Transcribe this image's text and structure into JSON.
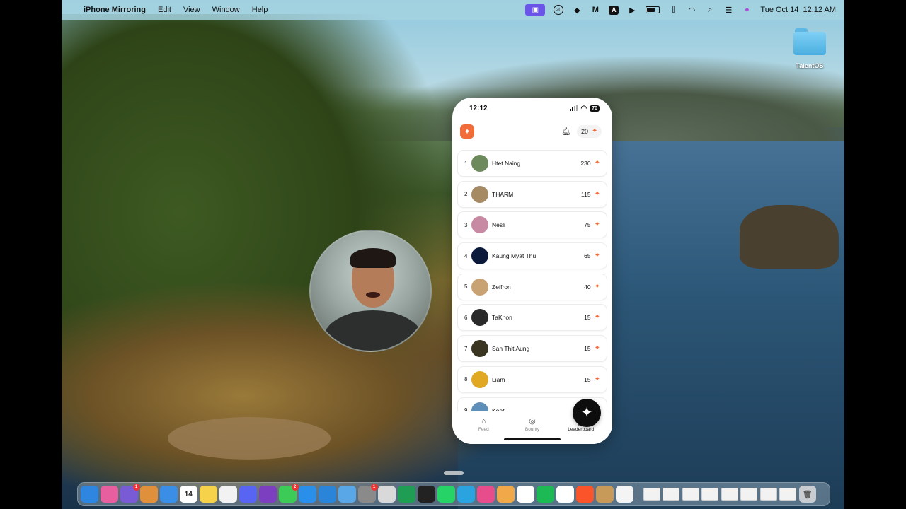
{
  "menubar": {
    "app_name": "iPhone Mirroring",
    "menus": [
      "Edit",
      "View",
      "Window",
      "Help"
    ],
    "status_icons": [
      "screen-mirroring-icon",
      "notification-count-icon",
      "dropbox-icon",
      "m-app-icon",
      "a-input-icon",
      "play-icon",
      "battery-icon",
      "tunnel-icon",
      "wifi-icon",
      "search-icon",
      "control-center-icon",
      "siri-icon"
    ],
    "notification_count": "20",
    "input_letter": "A",
    "datetime": "Tue Oct 14  12:12 AM"
  },
  "desktop": {
    "folder_label": "TalentOS"
  },
  "phone": {
    "status_time": "12:12",
    "battery": "70",
    "points": "20",
    "leaderboard": [
      {
        "rank": "1",
        "name": "Htet Naing",
        "score": "230",
        "avatar_color": "#6d8a5c"
      },
      {
        "rank": "2",
        "name": "THARM",
        "score": "115",
        "avatar_color": "#a58a63"
      },
      {
        "rank": "3",
        "name": "Nesli",
        "score": "75",
        "avatar_color": "#c78aa2"
      },
      {
        "rank": "4",
        "name": "Kaung Myat Thu",
        "score": "65",
        "avatar_color": "#0b1a3a"
      },
      {
        "rank": "5",
        "name": "Zeffron",
        "score": "40",
        "avatar_color": "#c9a273"
      },
      {
        "rank": "6",
        "name": "TaKhon",
        "score": "15",
        "avatar_color": "#2a2a2a"
      },
      {
        "rank": "7",
        "name": "San Thit Aung",
        "score": "15",
        "avatar_color": "#3a3520"
      },
      {
        "rank": "8",
        "name": "Liam",
        "score": "15",
        "avatar_color": "#e0a823"
      },
      {
        "rank": "9",
        "name": "Koof",
        "score": "",
        "avatar_color": "#5e8fb8"
      }
    ],
    "tabs": [
      {
        "label": "Feed",
        "icon": "home-icon"
      },
      {
        "label": "Bounty",
        "icon": "target-icon"
      },
      {
        "label": "Leaderboard",
        "icon": "podium-icon"
      }
    ]
  },
  "dock": {
    "apps": [
      {
        "name": "finder-icon",
        "color": "#2f86e0"
      },
      {
        "name": "arc-browser-icon",
        "color": "#e85fa0"
      },
      {
        "name": "viber-icon",
        "color": "#7a5bd6",
        "badge": "1"
      },
      {
        "name": "launchpad-icon",
        "color": "#e0903a"
      },
      {
        "name": "mail-icon",
        "color": "#3a8ee6"
      },
      {
        "name": "calendar-icon",
        "color": "#ffffff",
        "text": "14"
      },
      {
        "name": "notes-icon",
        "color": "#f6d14a"
      },
      {
        "name": "reminders-icon",
        "color": "#f2f2f2"
      },
      {
        "name": "discord-icon",
        "color": "#5865f2"
      },
      {
        "name": "github-desktop-icon",
        "color": "#7b3fbf"
      },
      {
        "name": "messages-icon",
        "color": "#3ccb56",
        "badge": "2"
      },
      {
        "name": "safari-icon",
        "color": "#2a8fe8"
      },
      {
        "name": "keynote-icon",
        "color": "#2a84d8"
      },
      {
        "name": "app-store-plugin-icon",
        "color": "#5aa7e8"
      },
      {
        "name": "system-settings-icon",
        "color": "#8a8a8a",
        "badge": "1"
      },
      {
        "name": "preview-icon",
        "color": "#d9d9d9"
      },
      {
        "name": "grammarly-icon",
        "color": "#1f9d55"
      },
      {
        "name": "link-app-icon",
        "color": "#222222"
      },
      {
        "name": "whatsapp-icon",
        "color": "#25d366"
      },
      {
        "name": "telegram-icon",
        "color": "#2aa3df"
      },
      {
        "name": "ai-app-icon",
        "color": "#e74c8b"
      },
      {
        "name": "sunrise-app-icon",
        "color": "#f0a848"
      },
      {
        "name": "chatgpt-icon",
        "color": "#ffffff"
      },
      {
        "name": "spotify-icon",
        "color": "#1db954"
      },
      {
        "name": "notion-icon",
        "color": "#ffffff"
      },
      {
        "name": "brave-icon",
        "color": "#fb542b"
      },
      {
        "name": "box-app-icon",
        "color": "#c79a5a"
      },
      {
        "name": "circle-app-icon",
        "color": "#f4f4f4"
      }
    ],
    "minimized_windows": 8,
    "trash_icon": "trash-icon"
  },
  "colors": {
    "accent": "#f26b3a",
    "fab": "#0d0d0d"
  }
}
